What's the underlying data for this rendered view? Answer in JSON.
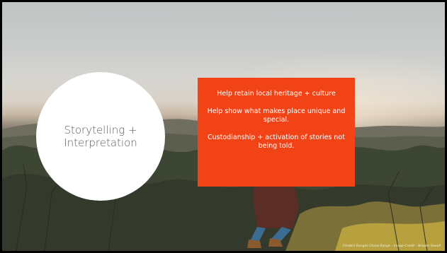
{
  "slide": {
    "circle_title": "Storytelling + Interpretation",
    "callout_points": [
      "Help retain local heritage + culture",
      "Help show what makes place unique and special.",
      "Custodianship + activation of stories not being told."
    ],
    "photo_credit": "Flinders Ranges Chace Range – Image Credit – Brooke Sewell"
  },
  "colors": {
    "callout_bg": "#f24317",
    "circle_bg": "#ffffff",
    "circle_text": "#5d5d5d"
  }
}
